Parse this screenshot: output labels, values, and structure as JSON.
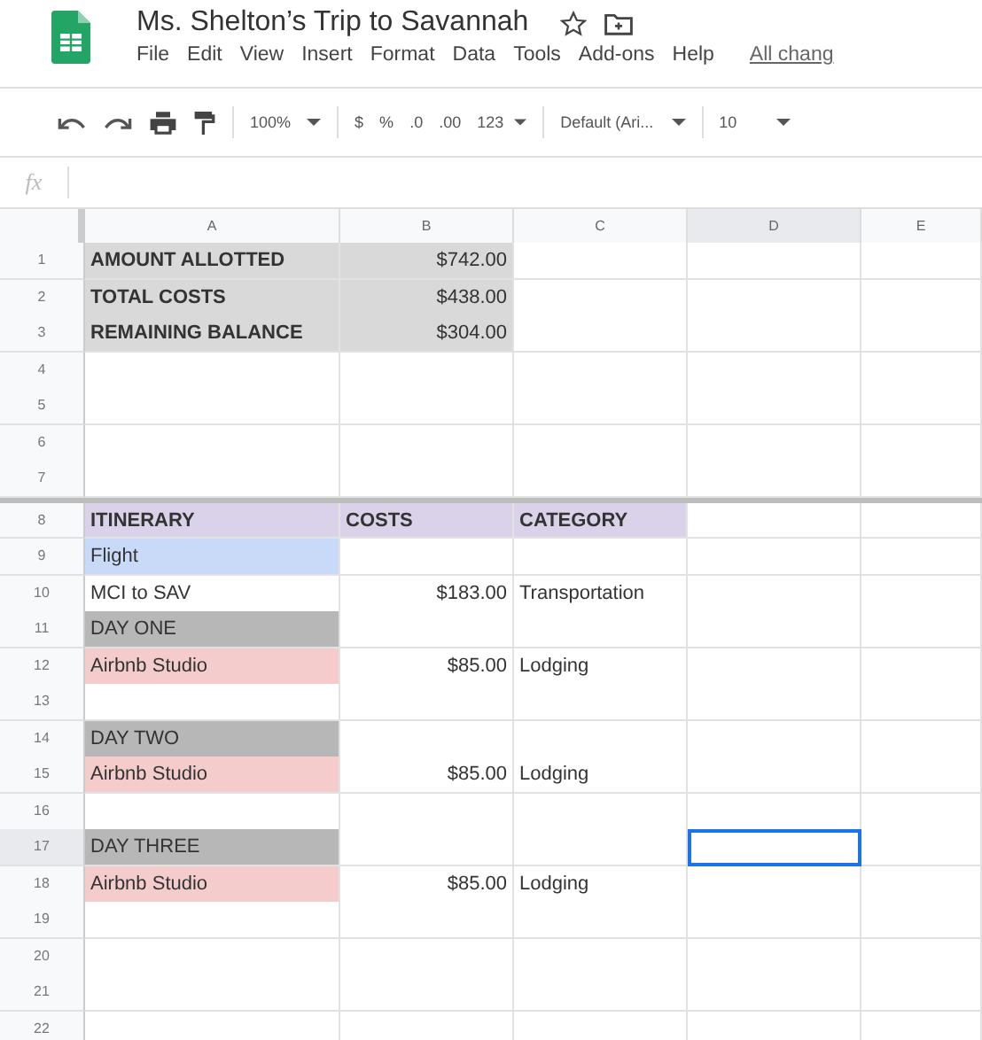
{
  "document": {
    "title": "Ms. Shelton’s Trip to Savannah",
    "starred": false,
    "menu": [
      "File",
      "Edit",
      "View",
      "Insert",
      "Format",
      "Data",
      "Tools",
      "Add-ons",
      "Help"
    ],
    "save_status": "All chang"
  },
  "toolbar": {
    "zoom": "100%",
    "currency": "$",
    "percent": "%",
    "decrease_decimals": ".0",
    "increase_decimals": ".00",
    "more_formats": "123",
    "font": "Default (Ari...",
    "font_size": "10"
  },
  "formula_bar": {
    "label": "fx"
  },
  "columns": [
    "A",
    "B",
    "C",
    "D",
    "E"
  ],
  "rows": [
    {
      "number": "1",
      "cells": [
        {
          "text": "AMOUNT ALLOTTED",
          "color": "#d9d9d9",
          "bold": true,
          "selected": false
        },
        {
          "text": "$742.00",
          "color": "#d9d9d9",
          "kind": "currency",
          "selected": false
        },
        {
          "selected": false
        },
        {
          "selected": false
        },
        {
          "selected": false
        }
      ]
    },
    {
      "number": "2",
      "cells": [
        {
          "text": "TOTAL COSTS",
          "color": "#d9d9d9",
          "bold": true,
          "selected": false
        },
        {
          "text": "$438.00",
          "color": "#d9d9d9",
          "kind": "currency",
          "selected": false
        },
        {
          "selected": false
        },
        {
          "selected": false
        },
        {
          "selected": false
        }
      ]
    },
    {
      "number": "3",
      "cells": [
        {
          "text": "REMAINING BALANCE",
          "color": "#d9d9d9",
          "bold": true,
          "selected": false
        },
        {
          "text": "$304.00",
          "color": "#d9d9d9",
          "kind": "currency",
          "selected": false
        },
        {
          "selected": false
        },
        {
          "selected": false
        },
        {
          "selected": false
        }
      ]
    },
    {
      "number": "4",
      "cells": [
        {
          "selected": false
        },
        {
          "selected": false
        },
        {
          "selected": false
        },
        {
          "selected": false
        },
        {
          "selected": false
        }
      ]
    },
    {
      "number": "5",
      "cells": [
        {
          "selected": false
        },
        {
          "selected": false
        },
        {
          "selected": false
        },
        {
          "selected": false
        },
        {
          "selected": false
        }
      ]
    },
    {
      "number": "6",
      "cells": [
        {
          "selected": false
        },
        {
          "selected": false
        },
        {
          "selected": false
        },
        {
          "selected": false
        },
        {
          "selected": false
        }
      ]
    },
    {
      "number": "7",
      "cells": [
        {
          "selected": false
        },
        {
          "selected": false
        },
        {
          "selected": false
        },
        {
          "selected": false
        },
        {
          "selected": false
        }
      ]
    },
    {
      "number": "8",
      "frozen_below": true,
      "cells": [
        {
          "text": "ITINERARY",
          "color": "#d9d2e9",
          "bold": true,
          "selected": false
        },
        {
          "text": "COSTS",
          "color": "#d9d2e9",
          "bold": true,
          "selected": false
        },
        {
          "text": "CATEGORY",
          "color": "#d9d2e9",
          "bold": true,
          "selected": false
        },
        {
          "selected": false
        },
        {
          "selected": false
        }
      ]
    },
    {
      "number": "9",
      "cells": [
        {
          "text": "Flight",
          "color": "#c9daf8",
          "selected": false
        },
        {
          "selected": false
        },
        {
          "selected": false
        },
        {
          "selected": false
        },
        {
          "selected": false
        }
      ]
    },
    {
      "number": "10",
      "cells": [
        {
          "text": "MCI to SAV",
          "selected": false
        },
        {
          "text": "$183.00",
          "kind": "currency",
          "selected": false
        },
        {
          "text": "Transportation",
          "selected": false
        },
        {
          "selected": false
        },
        {
          "selected": false
        }
      ]
    },
    {
      "number": "11",
      "cells": [
        {
          "text": "DAY ONE",
          "color": "#b7b7b7",
          "selected": false
        },
        {
          "selected": false
        },
        {
          "selected": false
        },
        {
          "selected": false
        },
        {
          "selected": false
        }
      ]
    },
    {
      "number": "12",
      "cells": [
        {
          "text": "Airbnb Studio",
          "color": "#f4cccc",
          "selected": false
        },
        {
          "text": "$85.00",
          "kind": "currency",
          "selected": false
        },
        {
          "text": "Lodging",
          "selected": false
        },
        {
          "selected": false
        },
        {
          "selected": false
        }
      ]
    },
    {
      "number": "13",
      "cells": [
        {
          "selected": false
        },
        {
          "selected": false
        },
        {
          "selected": false
        },
        {
          "selected": false
        },
        {
          "selected": false
        }
      ]
    },
    {
      "number": "14",
      "cells": [
        {
          "text": "DAY TWO",
          "color": "#b7b7b7",
          "selected": false
        },
        {
          "selected": false
        },
        {
          "selected": false
        },
        {
          "selected": false
        },
        {
          "selected": false
        }
      ]
    },
    {
      "number": "15",
      "cells": [
        {
          "text": "Airbnb Studio",
          "color": "#f4cccc",
          "selected": false
        },
        {
          "text": "$85.00",
          "kind": "currency",
          "selected": false
        },
        {
          "text": "Lodging",
          "selected": false
        },
        {
          "selected": false
        },
        {
          "selected": false
        }
      ]
    },
    {
      "number": "16",
      "cells": [
        {
          "selected": false
        },
        {
          "selected": false
        },
        {
          "selected": false
        },
        {
          "selected": false
        },
        {
          "selected": false
        }
      ]
    },
    {
      "number": "17",
      "cells": [
        {
          "text": "DAY THREE",
          "color": "#b7b7b7",
          "selected": false
        },
        {
          "selected": false
        },
        {
          "selected": false
        },
        {
          "selected": true
        },
        {
          "selected": false
        }
      ]
    },
    {
      "number": "18",
      "cells": [
        {
          "text": "Airbnb Studio",
          "color": "#f4cccc",
          "selected": false
        },
        {
          "text": "$85.00",
          "kind": "currency",
          "selected": false
        },
        {
          "text": "Lodging",
          "selected": false
        },
        {
          "selected": false
        },
        {
          "selected": false
        }
      ]
    },
    {
      "number": "19",
      "cells": [
        {
          "selected": false
        },
        {
          "selected": false
        },
        {
          "selected": false
        },
        {
          "selected": false
        },
        {
          "selected": false
        }
      ]
    },
    {
      "number": "20",
      "cells": [
        {
          "selected": false
        },
        {
          "selected": false
        },
        {
          "selected": false
        },
        {
          "selected": false
        },
        {
          "selected": false
        }
      ]
    },
    {
      "number": "21",
      "cells": [
        {
          "selected": false
        },
        {
          "selected": false
        },
        {
          "selected": false
        },
        {
          "selected": false
        },
        {
          "selected": false
        }
      ]
    },
    {
      "number": "22",
      "cells": [
        {
          "selected": false
        },
        {
          "selected": false
        },
        {
          "selected": false
        },
        {
          "selected": false
        },
        {
          "selected": false
        }
      ]
    }
  ]
}
